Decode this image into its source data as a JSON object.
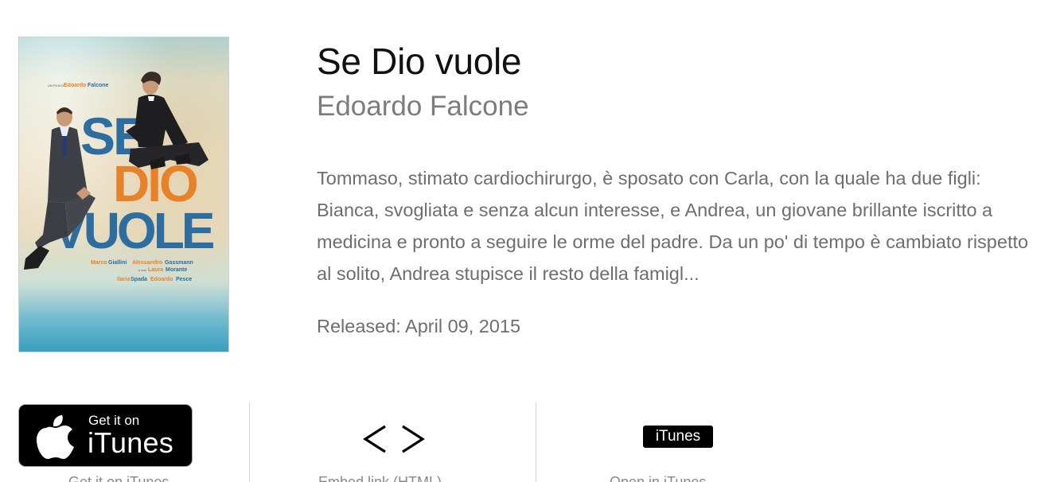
{
  "movie": {
    "title": "Se Dio vuole",
    "director": "Edoardo Falcone",
    "description": "Tommaso, stimato cardiochirurgo, è sposato con Carla, con la quale ha due figli: Bianca, svogliata e senza alcun interesse, e Andrea, un giovane brillante iscritto a medicina e pronto a seguire le orme del padre. Da un po' di tempo è cambiato rispetto al solito, Andrea stupisce il resto della famigl...",
    "released": "Released: April 09, 2015"
  },
  "poster": {
    "credit_prefix": "UN FILM DI",
    "credit_director_first": "Edoardo",
    "credit_director_last": "Falcone",
    "title_line1": "SE",
    "title_line2": "DIO",
    "title_line3": "VUOLE",
    "cast_line1_a": "Marco",
    "cast_line1_b": "Giallini",
    "cast_line1_c": "Alessandro",
    "cast_line1_d": "Gassmann",
    "cast_line2_prefix": "e con",
    "cast_line2_a": "Laura",
    "cast_line2_b": "Morante",
    "cast_line3_a": "Ilaria",
    "cast_line3_b": "Spada",
    "cast_line3_c": "Edoardo",
    "cast_line3_d": "Pesce",
    "colors": {
      "blue": "#2e6da0",
      "orange": "#e8822a",
      "dark": "#2b2b2b"
    }
  },
  "actions": {
    "badge_small": "Get it on",
    "badge_big": "iTunes",
    "badge_label": "Get it on iTunes",
    "embed_label": "Embed link (HTML)",
    "itunes_tag": "iTunes",
    "itunes_label": "Open in iTunes"
  }
}
